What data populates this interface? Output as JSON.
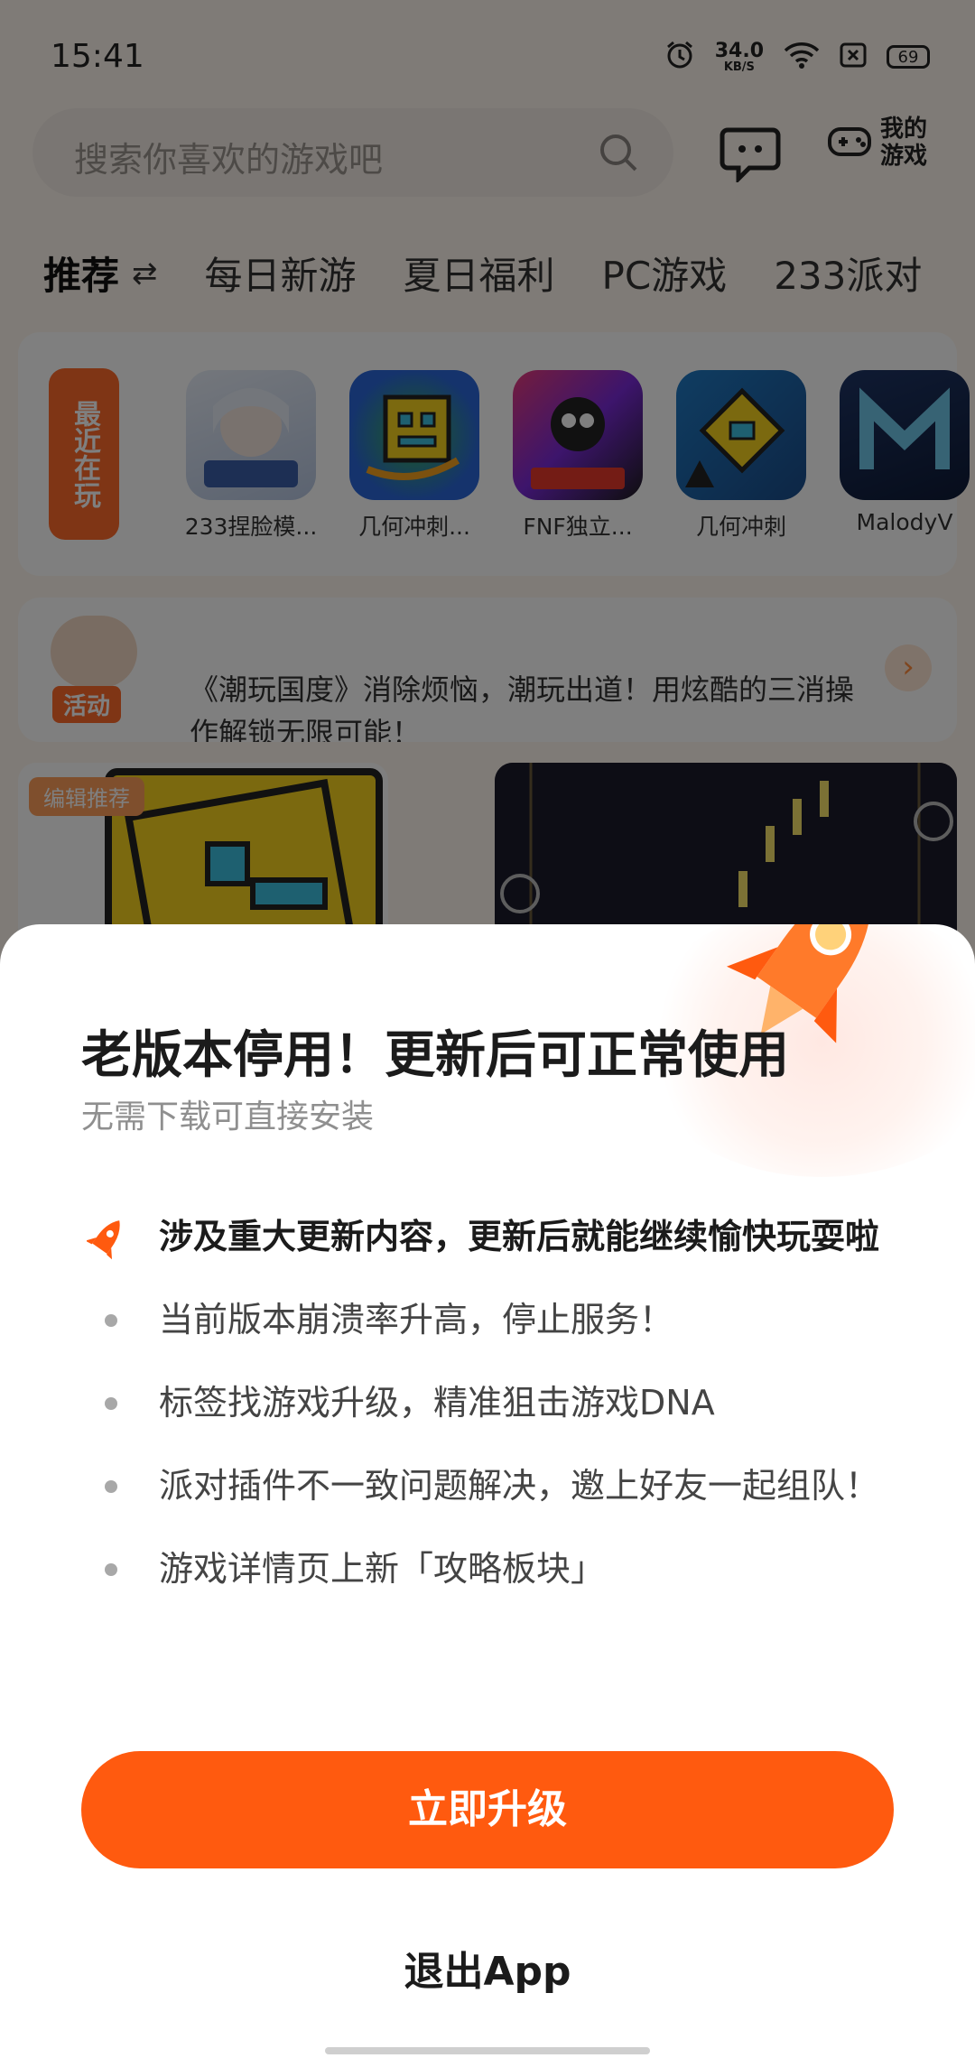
{
  "status": {
    "time": "15:41",
    "speed": "34.0",
    "speed_unit": "KB/S",
    "battery": "69"
  },
  "header": {
    "search_placeholder": "搜索你喜欢的游戏吧",
    "my_games": "我的游戏"
  },
  "tabs": [
    {
      "label": "推荐"
    },
    {
      "label": "每日新游"
    },
    {
      "label": "夏日福利"
    },
    {
      "label": "PC游戏"
    },
    {
      "label": "233派对"
    }
  ],
  "recent": {
    "label": "最近在玩",
    "games": [
      {
        "name": "233捏脸模...",
        "color": "#c9d6ea"
      },
      {
        "name": "几何冲刺...",
        "color": "#2a67d8"
      },
      {
        "name": "FNF独立...",
        "color": "#1c1c1c"
      },
      {
        "name": "几何冲刺",
        "color": "#1f7ac4"
      },
      {
        "name": "MalodyV",
        "color": "#14254d"
      }
    ]
  },
  "notice": {
    "badge": "活动",
    "text": "《潮玩国度》消除烦恼，潮玩出道！用炫酷的三消操作解锁无限可能！"
  },
  "cards": {
    "edit_badge": "编辑推荐"
  },
  "dialog": {
    "title": "老版本停用！更新后可正常使用",
    "subtitle": "无需下载可直接安装",
    "headline": "涉及重大更新内容，更新后就能继续愉快玩耍啦",
    "items": [
      "当前版本崩溃率升高，停止服务！",
      "标签找游戏升级，精准狙击游戏DNA",
      "派对插件不一致问题解决，邀上好友一起组队！",
      "游戏详情页上新「攻略板块」"
    ],
    "upgrade_label": "立即升级",
    "exit_label": "退出App"
  },
  "colors": {
    "accent": "#ff5a0f",
    "overlay": "rgba(0,0,0,0.5)"
  }
}
